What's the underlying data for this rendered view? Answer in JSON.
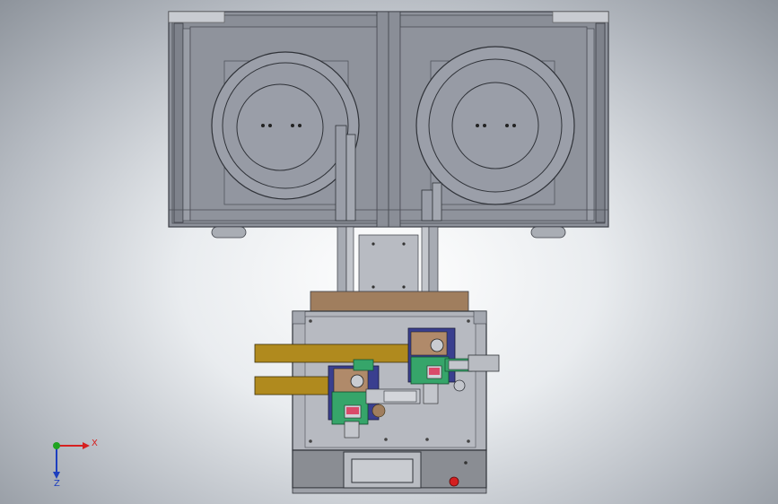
{
  "viewport": {
    "background": "#c9ced4",
    "machine_color": "#8e929b",
    "frame_color": "#7b7f88",
    "bowl_color": "#9498a3",
    "plate_color": "#b4b7be",
    "wood_color": "#a07e5e",
    "rail_color": "#b08a1e",
    "green_color": "#36a56a",
    "blue_color": "#3a3f8f"
  },
  "triad": {
    "x_label": "X",
    "z_label": "Z",
    "x_color": "#d62020",
    "z_color": "#1d3fbf",
    "y_color": "#1fa31f"
  }
}
